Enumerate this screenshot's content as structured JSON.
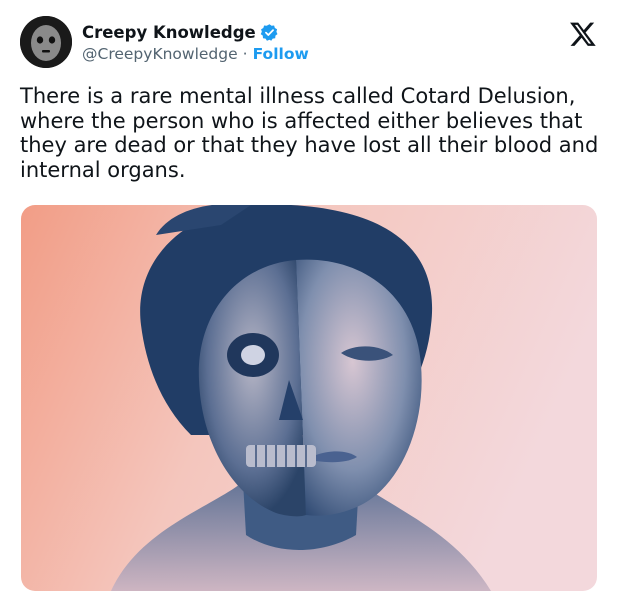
{
  "author": {
    "display_name": "Creepy Knowledge",
    "handle": "@CreepyKnowledge",
    "separator": "·",
    "follow_label": "Follow",
    "verified": true
  },
  "platform_icon": "x-logo-icon",
  "tweet": {
    "text": "There is a rare mental illness called Cotard Delusion, where the person who is affected either believes that they are dead or that they have lost all their blood and internal organs."
  },
  "media": {
    "icon": "photo-woman-half-skull"
  },
  "colors": {
    "follow_blue": "#1d9bf0",
    "verified_blue": "#1d9bf0",
    "text_primary": "#0f1419",
    "text_secondary": "#536471",
    "image_pink": "#f2a08a",
    "image_blue": "#2e4a72"
  }
}
